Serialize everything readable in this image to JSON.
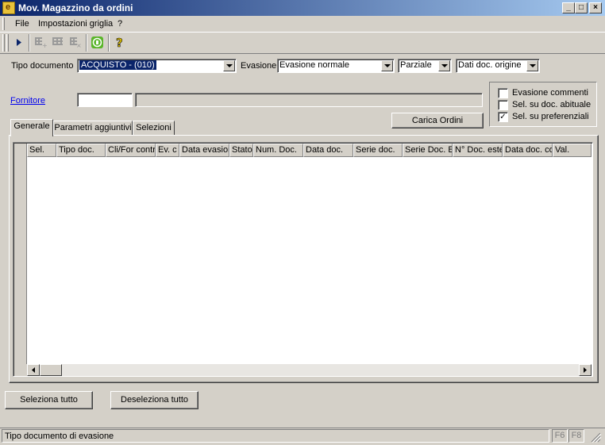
{
  "window": {
    "title": "Mov. Magazzino da ordini",
    "app_icon_glyph": "e",
    "caption_buttons": [
      "_",
      "□",
      "×"
    ]
  },
  "menu": {
    "items": [
      "File",
      "Impostazioni griglia",
      "?"
    ]
  },
  "toolbar": {
    "icons": [
      "play-icon",
      "select-all-rows-icon",
      "grid-icon",
      "deselect-rows-icon",
      "phone-icon",
      "help-icon"
    ]
  },
  "form": {
    "tipo_documento_label": "Tipo documento",
    "tipo_documento_value": "ACQUISTO - (010)",
    "evasione_label": "Evasione",
    "evasione_value": "Evasione normale",
    "parziale_value": "Parziale",
    "dati_value": "Dati doc. origine",
    "fornitore_label": "Fornitore",
    "fornitore_code": "",
    "fornitore_name": "",
    "carica_ordini_label": "Carica Ordini"
  },
  "options": {
    "evasione_commenti": {
      "label": "Evasione commenti",
      "checked": false
    },
    "sel_doc_abituale": {
      "label": "Sel. su doc. abituale",
      "checked": false
    },
    "sel_preferenziali": {
      "label": "Sel. su preferenziali",
      "checked": true
    }
  },
  "tabs": [
    "Generale",
    "Parametri aggiuntivi",
    "Selezioni"
  ],
  "grid": {
    "columns": [
      "Sel.",
      "Tipo doc.",
      "Cli/For contr.",
      "Ev. c",
      "Data evasion",
      "Stato",
      "Num. Doc.",
      "Data doc.",
      "Serie doc.",
      "Serie Doc. E",
      "N° Doc. este",
      "Data doc. co",
      "Val."
    ],
    "rows": []
  },
  "buttons": {
    "seleziona_tutto": "Seleziona tutto",
    "deseleziona_tutto": "Deseleziona tutto"
  },
  "statusbar": {
    "text": "Tipo documento di evasione",
    "keys": [
      "F6",
      "F8"
    ]
  }
}
